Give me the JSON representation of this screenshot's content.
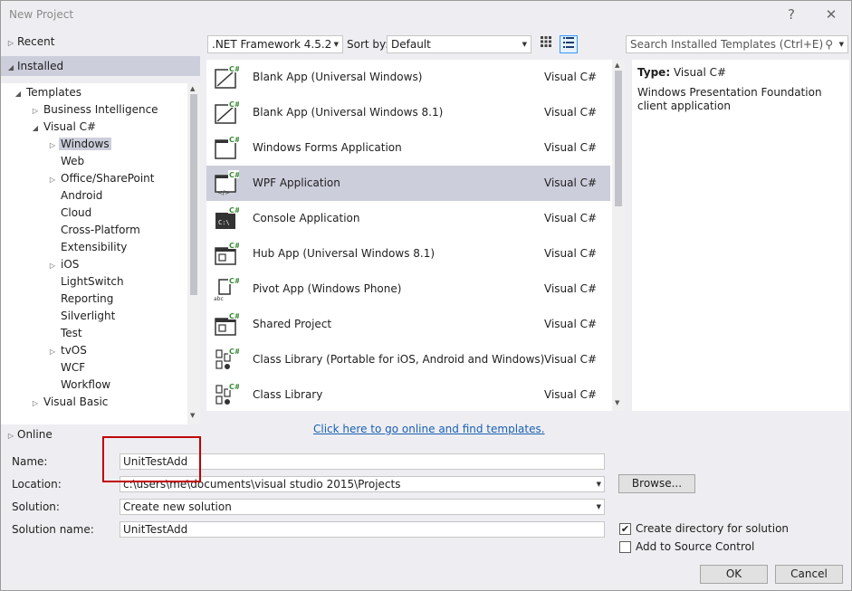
{
  "window": {
    "title": "New Project",
    "help_label": "?",
    "close_label": "✕"
  },
  "left": {
    "recent": "Recent",
    "installed": "Installed",
    "online": "Online",
    "tree": [
      {
        "label": "Templates",
        "level": 0,
        "arrow": "expanded"
      },
      {
        "label": "Business Intelligence",
        "level": 1,
        "arrow": "collapsed"
      },
      {
        "label": "Visual C#",
        "level": 1,
        "arrow": "expanded"
      },
      {
        "label": "Windows",
        "level": 2,
        "arrow": "collapsed",
        "selected": true
      },
      {
        "label": "Web",
        "level": 2,
        "arrow": "none"
      },
      {
        "label": "Office/SharePoint",
        "level": 2,
        "arrow": "collapsed"
      },
      {
        "label": "Android",
        "level": 2,
        "arrow": "none"
      },
      {
        "label": "Cloud",
        "level": 2,
        "arrow": "none"
      },
      {
        "label": "Cross-Platform",
        "level": 2,
        "arrow": "none"
      },
      {
        "label": "Extensibility",
        "level": 2,
        "arrow": "none"
      },
      {
        "label": "iOS",
        "level": 2,
        "arrow": "collapsed"
      },
      {
        "label": "LightSwitch",
        "level": 2,
        "arrow": "none"
      },
      {
        "label": "Reporting",
        "level": 2,
        "arrow": "none"
      },
      {
        "label": "Silverlight",
        "level": 2,
        "arrow": "none"
      },
      {
        "label": "Test",
        "level": 2,
        "arrow": "none"
      },
      {
        "label": "tvOS",
        "level": 2,
        "arrow": "collapsed"
      },
      {
        "label": "WCF",
        "level": 2,
        "arrow": "none"
      },
      {
        "label": "Workflow",
        "level": 2,
        "arrow": "none"
      },
      {
        "label": "Visual Basic",
        "level": 1,
        "arrow": "collapsed"
      }
    ]
  },
  "toolbar": {
    "framework": ".NET Framework 4.5.2",
    "sort_label": "Sort by:",
    "sort_value": "Default",
    "search_placeholder": "Search Installed Templates (Ctrl+E)"
  },
  "templates": [
    {
      "name": "Blank App (Universal Windows)",
      "lang": "Visual C#",
      "icon": "blank-app-icon"
    },
    {
      "name": "Blank App (Universal Windows 8.1)",
      "lang": "Visual C#",
      "icon": "blank-app-icon"
    },
    {
      "name": "Windows Forms Application",
      "lang": "Visual C#",
      "icon": "windows-forms-icon"
    },
    {
      "name": "WPF Application",
      "lang": "Visual C#",
      "icon": "wpf-icon",
      "selected": true
    },
    {
      "name": "Console Application",
      "lang": "Visual C#",
      "icon": "console-icon"
    },
    {
      "name": "Hub App (Universal Windows 8.1)",
      "lang": "Visual C#",
      "icon": "hub-app-icon"
    },
    {
      "name": "Pivot App (Windows Phone)",
      "lang": "Visual C#",
      "icon": "pivot-app-icon"
    },
    {
      "name": "Shared Project",
      "lang": "Visual C#",
      "icon": "shared-project-icon"
    },
    {
      "name": "Class Library (Portable for iOS, Android and Windows)",
      "lang": "Visual C#",
      "icon": "class-library-icon"
    },
    {
      "name": "Class Library",
      "lang": "Visual C#",
      "icon": "class-library-icon"
    }
  ],
  "description": {
    "type_label": "Type:",
    "type_value": "Visual C#",
    "text": "Windows Presentation Foundation client application"
  },
  "online_link": "Click here to go online and find templates.",
  "form": {
    "name_label": "Name:",
    "name_value": "UnitTestAdd",
    "location_label": "Location:",
    "location_value": "c:\\users\\me\\documents\\visual studio 2015\\Projects",
    "solution_label": "Solution:",
    "solution_value": "Create new solution",
    "solution_name_label": "Solution name:",
    "solution_name_value": "UnitTestAdd",
    "browse_label": "Browse...",
    "create_dir_label": "Create directory for solution",
    "create_dir_checked": true,
    "source_control_label": "Add to Source Control",
    "source_control_checked": false,
    "ok_label": "OK",
    "cancel_label": "Cancel"
  },
  "colors": {
    "selection": "#cccedb",
    "link": "#1a5fb4",
    "highlight_box": "#c00000",
    "csharp_badge": "#388a34"
  }
}
